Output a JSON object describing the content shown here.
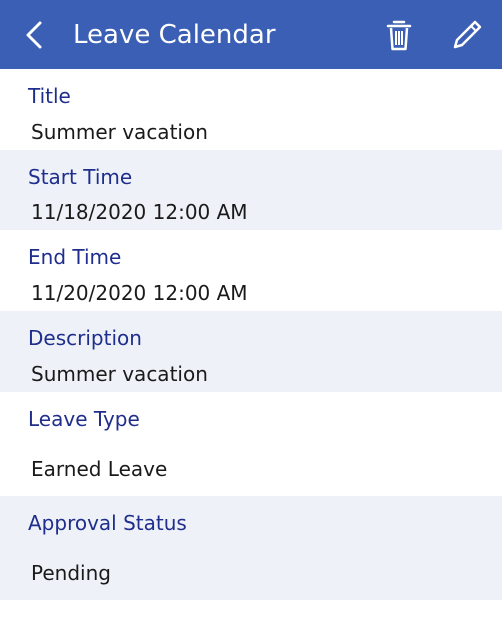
{
  "header": {
    "title": "Leave Calendar",
    "color": "#3a5fb5",
    "icons": {
      "back": "chevron-left-icon",
      "delete": "trash-icon",
      "edit": "pencil-icon"
    }
  },
  "fields": {
    "title": {
      "label": "Title",
      "value": "Summer vacation"
    },
    "start_time": {
      "label": "Start Time",
      "value": "11/18/2020 12:00 AM"
    },
    "end_time": {
      "label": "End Time",
      "value": "11/20/2020 12:00 AM"
    },
    "description": {
      "label": "Description",
      "value": "Summer vacation"
    },
    "leave_type": {
      "label": "Leave Type",
      "value": "Earned Leave"
    },
    "approval_status": {
      "label": "Approval Status",
      "value": "Pending"
    }
  },
  "colors": {
    "label": "#1f2e8c",
    "value": "#1a1a1a",
    "alt_row": "#eef2f8"
  }
}
